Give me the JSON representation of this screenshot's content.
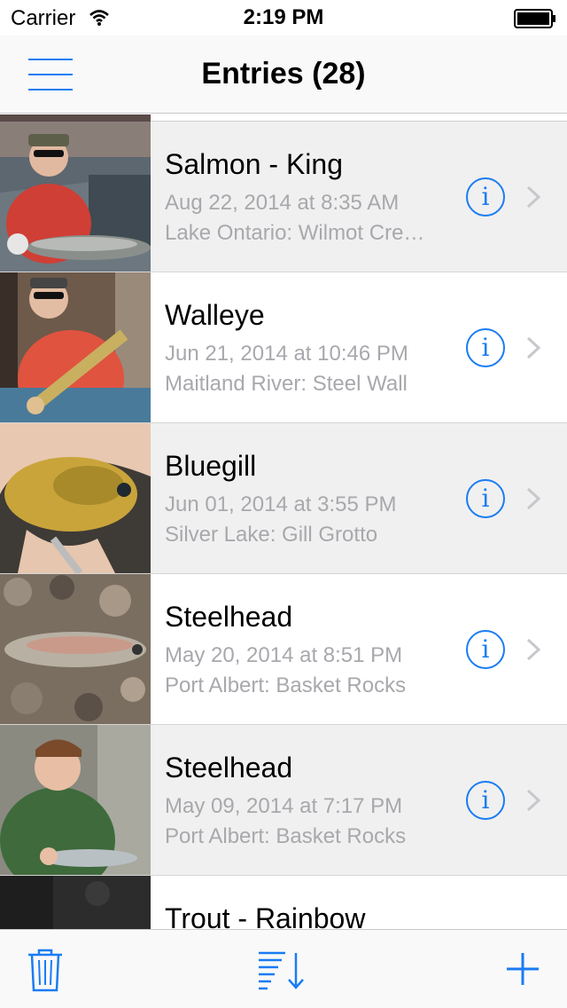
{
  "status_bar": {
    "carrier": "Carrier",
    "time": "2:19 PM"
  },
  "nav": {
    "title": "Entries (28)",
    "menu_icon": "hamburger-menu-icon"
  },
  "entries": [
    {
      "species": "Salmon - King",
      "date": "Aug 22, 2014 at 8:35 AM",
      "location": "Lake Ontario: Wilmot Cre…",
      "photo": "angler-boat-salmon"
    },
    {
      "species": "Walleye",
      "date": "Jun 21, 2014 at 10:46 PM",
      "location": "Maitland River: Steel Wall",
      "photo": "angler-walleye"
    },
    {
      "species": "Bluegill",
      "date": "Jun 01, 2014 at 3:55 PM",
      "location": "Silver Lake: Gill Grotto",
      "photo": "hand-bluegill"
    },
    {
      "species": "Steelhead",
      "date": "May 20, 2014 at 8:51 PM",
      "location": "Port Albert: Basket Rocks",
      "photo": "steelhead-on-rocks"
    },
    {
      "species": "Steelhead",
      "date": "May 09, 2014 at 7:17 PM",
      "location": "Port Albert: Basket Rocks",
      "photo": "angler-steelhead"
    },
    {
      "species": "Trout - Rainbow",
      "date": "",
      "location": "",
      "photo": "dark-partial"
    }
  ],
  "info_glyph": "i",
  "toolbar": {
    "trash_icon": "trash-icon",
    "sort_icon": "sort-descending-icon",
    "add_icon": "plus-icon"
  },
  "colors": {
    "accent": "#1a7cf3",
    "row_shaded": "#f0f0f0",
    "secondary_text": "#a8a8ad"
  }
}
